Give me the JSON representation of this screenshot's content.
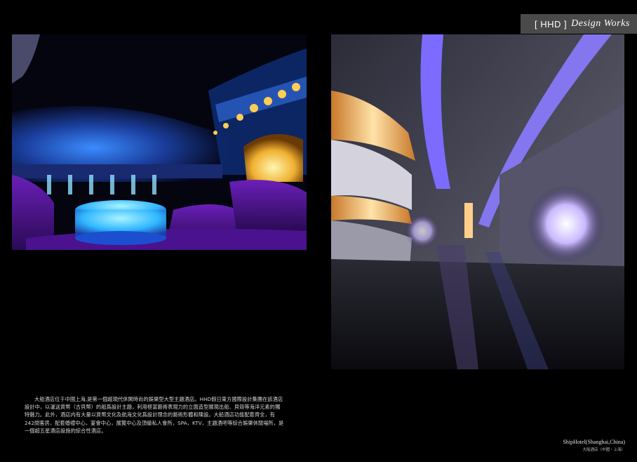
{
  "header": {
    "brand_code": "[ HHD ]",
    "brand_script": "Design Works"
  },
  "images": {
    "left": "bar-interior-photo",
    "right": "corridor-interior-photo"
  },
  "description": "大船酒店位于中國上海,是第一個超現代休閑時尚的娛樂型大型主題酒店。HHD假日東方國際設計集團在該酒店設計中，以運送貨幣（古貝幣）的船爲設計主題，利用極富藝術表現力的立面造型展現出船、貝殼等海洋元素的獨特魅力。此外，酒店内有大量以貨幣文化及航海文化爲設計理念的藝術形體和陳設。大船酒店功能配套齊全，有242間客房，配套婚禮中心，宴會中心，展覽中心及頂級私人會所，SPA，KTV，主題酒吧等綜合娛樂休閒場所，是一個超五星酒店設施的綜合性酒店。",
  "caption": {
    "english": "ShipHotel(Shanghai,China)",
    "chinese": "大船酒店（中國・上海）"
  },
  "colors": {
    "background": "#000000",
    "brand_bar": "#4a4a4a",
    "accent_purple": "#7a2cc4",
    "accent_blue": "#2f6cff"
  }
}
